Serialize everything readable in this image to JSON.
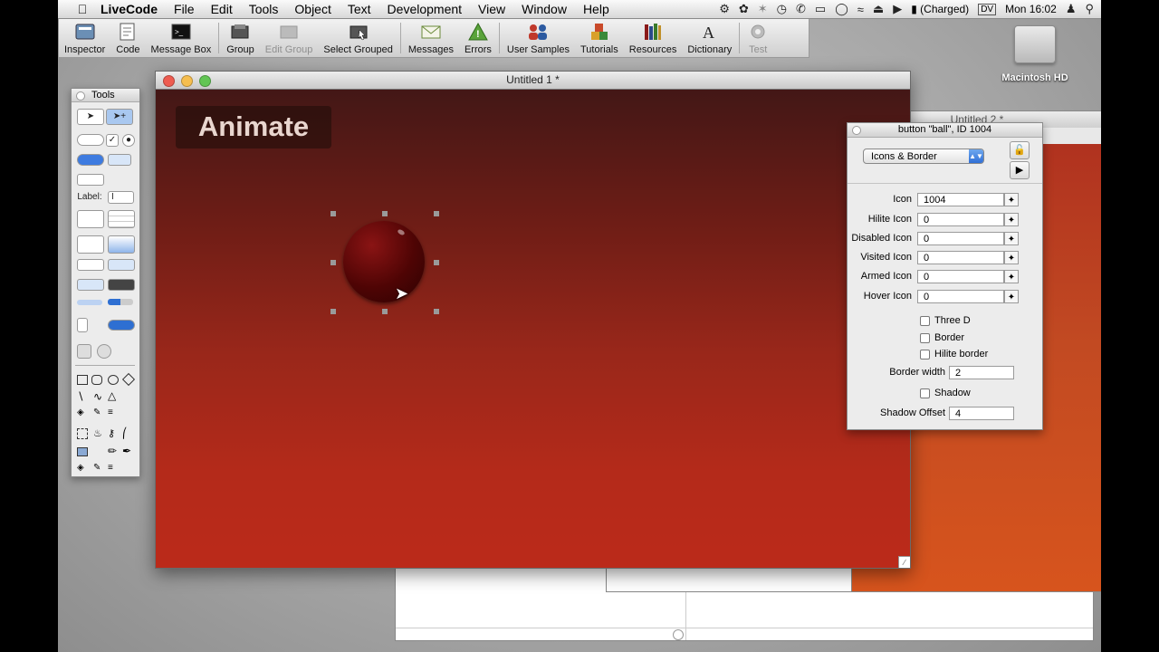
{
  "menubar": {
    "items": [
      "LiveCode",
      "File",
      "Edit",
      "Tools",
      "Object",
      "Text",
      "Development",
      "View",
      "Window",
      "Help"
    ],
    "battery": "(Charged)",
    "input_source": "DV",
    "clock": "Mon 16:02",
    "status_icons": [
      "gear-icon",
      "script-icon",
      "bluetooth-icon",
      "time-machine-icon",
      "phone-icon",
      "display-icon",
      "speech-icon",
      "wifi-icon",
      "eject-icon",
      "volume-icon",
      "battery-icon",
      "user-icon",
      "spotlight-icon"
    ]
  },
  "toolbar": {
    "items": [
      {
        "label": "Inspector",
        "icon": "inspector-icon",
        "enabled": true
      },
      {
        "label": "Code",
        "icon": "code-icon",
        "enabled": true
      },
      {
        "label": "Message Box",
        "icon": "message-box-icon",
        "enabled": true
      },
      {
        "label": "Group",
        "icon": "group-icon",
        "enabled": true
      },
      {
        "label": "Edit Group",
        "icon": "edit-group-icon",
        "enabled": false
      },
      {
        "label": "Select Grouped",
        "icon": "select-grouped-icon",
        "enabled": true
      },
      {
        "label": "Messages",
        "icon": "envelope-icon",
        "enabled": true
      },
      {
        "label": "Errors",
        "icon": "warning-icon",
        "enabled": true
      },
      {
        "label": "User Samples",
        "icon": "users-icon",
        "enabled": true
      },
      {
        "label": "Tutorials",
        "icon": "blocks-icon",
        "enabled": true
      },
      {
        "label": "Resources",
        "icon": "books-icon",
        "enabled": true
      },
      {
        "label": "Dictionary",
        "icon": "dictionary-icon",
        "enabled": true
      },
      {
        "label": "Test",
        "icon": "test-gear-icon",
        "enabled": false
      }
    ]
  },
  "desktop": {
    "drive_label": "Macintosh HD"
  },
  "window2": {
    "title": "Untitled 2 *"
  },
  "window1": {
    "title": "Untitled 1 *",
    "animate_button": "Animate"
  },
  "tools_palette": {
    "title": "Tools",
    "label_tool": "Label:",
    "field_tool": "I"
  },
  "inspector": {
    "title": "button \"ball\", ID 1004",
    "section": "Icons & Border",
    "fields": [
      {
        "label": "Icon",
        "value": "1004"
      },
      {
        "label": "Hilite Icon",
        "value": "0"
      },
      {
        "label": "Disabled Icon",
        "value": "0"
      },
      {
        "label": "Visited Icon",
        "value": "0"
      },
      {
        "label": "Armed Icon",
        "value": "0"
      },
      {
        "label": "Hover Icon",
        "value": "0"
      }
    ],
    "checkboxes": [
      {
        "label": "Three D",
        "checked": false
      },
      {
        "label": "Border",
        "checked": false
      },
      {
        "label": "Hilite border",
        "checked": false
      }
    ],
    "border_width_label": "Border width",
    "border_width": "2",
    "shadow_label": "Shadow",
    "shadow_checked": false,
    "shadow_offset_label": "Shadow Offset",
    "shadow_offset": "4"
  },
  "colors": {
    "card_top": "#431716",
    "card_bottom": "#bb2a1a",
    "accent_blue": "#2f6fd6",
    "ball": "#4e0404"
  }
}
